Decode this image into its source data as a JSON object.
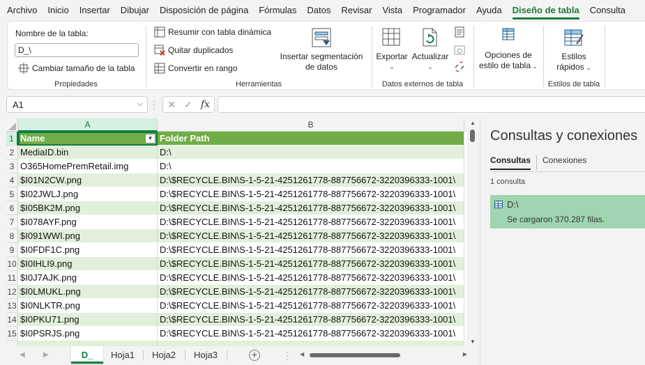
{
  "menu": [
    "Archivo",
    "Inicio",
    "Insertar",
    "Dibujar",
    "Disposición de página",
    "Fórmulas",
    "Datos",
    "Revisar",
    "Vista",
    "Programador",
    "Ayuda",
    "Diseño de tabla",
    "Consulta"
  ],
  "menu_active": "Diseño de tabla",
  "ribbon": {
    "propiedades": {
      "title": "Propiedades",
      "table_name_label": "Nombre de la tabla:",
      "table_name_value": "D_\\",
      "resize": "Cambiar tamaño de la tabla"
    },
    "herramientas": {
      "title": "Herramientas",
      "pivot": "Resumir con tabla dinámica",
      "remove_dup": "Quitar duplicados",
      "convert": "Convertir en rango",
      "slicer_line1": "Insertar segmentación",
      "slicer_line2": "de datos"
    },
    "externos": {
      "title": "Datos externos de tabla",
      "export": "Exportar",
      "refresh": "Actualizar"
    },
    "opciones": {
      "line1": "Opciones de",
      "line2": "estilo de tabla"
    },
    "estilos": {
      "title": "Estilos de tabla",
      "line1": "Estilos",
      "line2": "rápidos"
    }
  },
  "formula_bar": {
    "name_box": "A1",
    "fx": "fx",
    "formula": ""
  },
  "grid": {
    "columns": [
      "A",
      "B"
    ],
    "rows": [
      {
        "n": "1",
        "a": "Name",
        "b": "Folder Path"
      },
      {
        "n": "2",
        "a": "MediaID.bin",
        "b": "D:\\"
      },
      {
        "n": "3",
        "a": "O365HomePremRetail.img",
        "b": "D:\\"
      },
      {
        "n": "4",
        "a": "$I01N2CW.png",
        "b": "D:\\$RECYCLE.BIN\\S-1-5-21-4251261778-887756672-3220396333-1001\\"
      },
      {
        "n": "5",
        "a": "$I02JWLJ.png",
        "b": "D:\\$RECYCLE.BIN\\S-1-5-21-4251261778-887756672-3220396333-1001\\"
      },
      {
        "n": "6",
        "a": "$I05BK2M.png",
        "b": "D:\\$RECYCLE.BIN\\S-1-5-21-4251261778-887756672-3220396333-1001\\"
      },
      {
        "n": "7",
        "a": "$I078AYF.png",
        "b": "D:\\$RECYCLE.BIN\\S-1-5-21-4251261778-887756672-3220396333-1001\\"
      },
      {
        "n": "8",
        "a": "$I091WWI.png",
        "b": "D:\\$RECYCLE.BIN\\S-1-5-21-4251261778-887756672-3220396333-1001\\"
      },
      {
        "n": "9",
        "a": "$I0FDF1C.png",
        "b": "D:\\$RECYCLE.BIN\\S-1-5-21-4251261778-887756672-3220396333-1001\\"
      },
      {
        "n": "10",
        "a": "$I0IHLI9.png",
        "b": "D:\\$RECYCLE.BIN\\S-1-5-21-4251261778-887756672-3220396333-1001\\"
      },
      {
        "n": "11",
        "a": "$I0J7AJK.png",
        "b": "D:\\$RECYCLE.BIN\\S-1-5-21-4251261778-887756672-3220396333-1001\\"
      },
      {
        "n": "12",
        "a": "$I0LMUKL.png",
        "b": "D:\\$RECYCLE.BIN\\S-1-5-21-4251261778-887756672-3220396333-1001\\"
      },
      {
        "n": "13",
        "a": "$I0NLKTR.png",
        "b": "D:\\$RECYCLE.BIN\\S-1-5-21-4251261778-887756672-3220396333-1001\\"
      },
      {
        "n": "14",
        "a": "$I0PKU71.png",
        "b": "D:\\$RECYCLE.BIN\\S-1-5-21-4251261778-887756672-3220396333-1001\\"
      },
      {
        "n": "15",
        "a": "$I0PSRJS.png",
        "b": "D:\\$RECYCLE.BIN\\S-1-5-21-4251261778-887756672-3220396333-1001\\"
      }
    ]
  },
  "sheets": [
    "D_",
    "Hoja1",
    "Hoja2",
    "Hoja3"
  ],
  "active_sheet": "D_",
  "pane": {
    "title": "Consultas y conexiones",
    "tab_queries": "Consultas",
    "tab_connections": "Conexiones",
    "count": "1 consulta",
    "query_name": "D:\\",
    "query_status": "Se cargaron 370.287 filas."
  },
  "colors": {
    "accent": "#107c41",
    "table_header": "#70ad47",
    "table_band": "#e2efda",
    "query_selected": "#9fd5b0"
  }
}
